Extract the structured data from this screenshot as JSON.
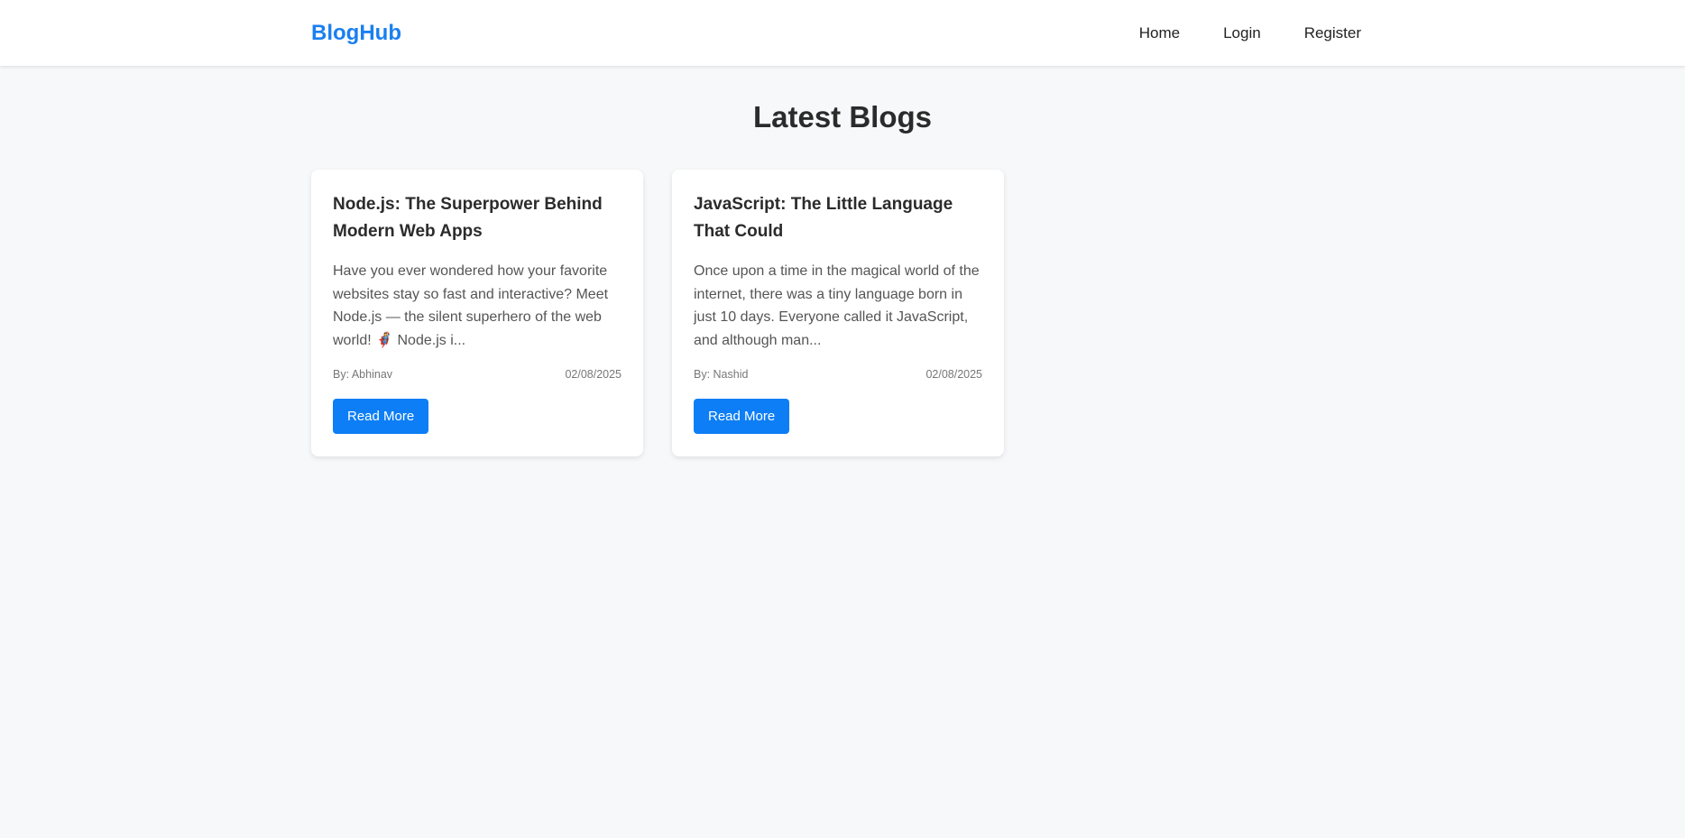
{
  "navbar": {
    "brand": "BlogHub",
    "links": [
      {
        "label": "Home"
      },
      {
        "label": "Login"
      },
      {
        "label": "Register"
      }
    ]
  },
  "main": {
    "title": "Latest Blogs",
    "posts": [
      {
        "title": "Node.js: The Superpower Behind Modern Web Apps",
        "excerpt": "Have you ever wondered how your favorite websites stay so fast and interactive? Meet Node.js — the silent superhero of the web world! 🦸 Node.js i...",
        "author": "By: Abhinav",
        "date": "02/08/2025",
        "button_label": "Read More"
      },
      {
        "title": "JavaScript: The Little Language That Could",
        "excerpt": "Once upon a time in the magical world of the internet, there was a tiny language born in just 10 days. Everyone called it JavaScript, and although man...",
        "author": "By: Nashid",
        "date": "02/08/2025",
        "button_label": "Read More"
      }
    ]
  },
  "colors": {
    "accent": "#1a7ff0",
    "button": "#0d7ef5",
    "background": "#f7f8fa"
  }
}
